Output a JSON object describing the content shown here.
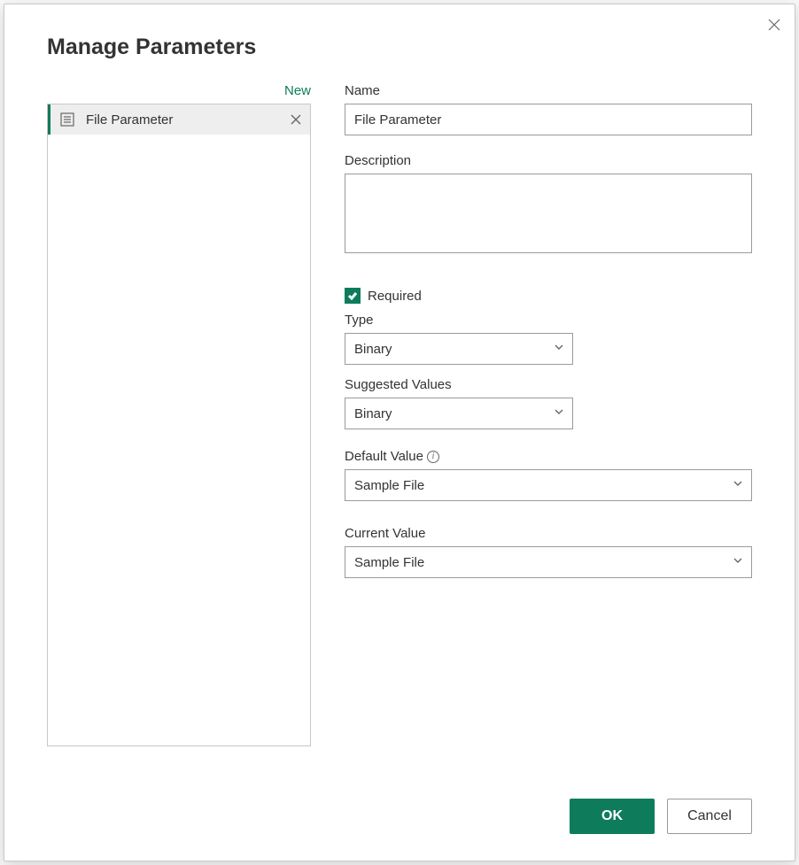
{
  "dialog": {
    "title": "Manage Parameters"
  },
  "sidebar": {
    "new_label": "New",
    "items": [
      {
        "label": "File Parameter"
      }
    ]
  },
  "form": {
    "name_label": "Name",
    "name_value": "File Parameter",
    "description_label": "Description",
    "description_value": "",
    "required_label": "Required",
    "required_checked": true,
    "type_label": "Type",
    "type_value": "Binary",
    "suggested_label": "Suggested Values",
    "suggested_value": "Binary",
    "default_label": "Default Value",
    "default_value": "Sample File",
    "current_label": "Current Value",
    "current_value": "Sample File"
  },
  "footer": {
    "ok_label": "OK",
    "cancel_label": "Cancel"
  }
}
